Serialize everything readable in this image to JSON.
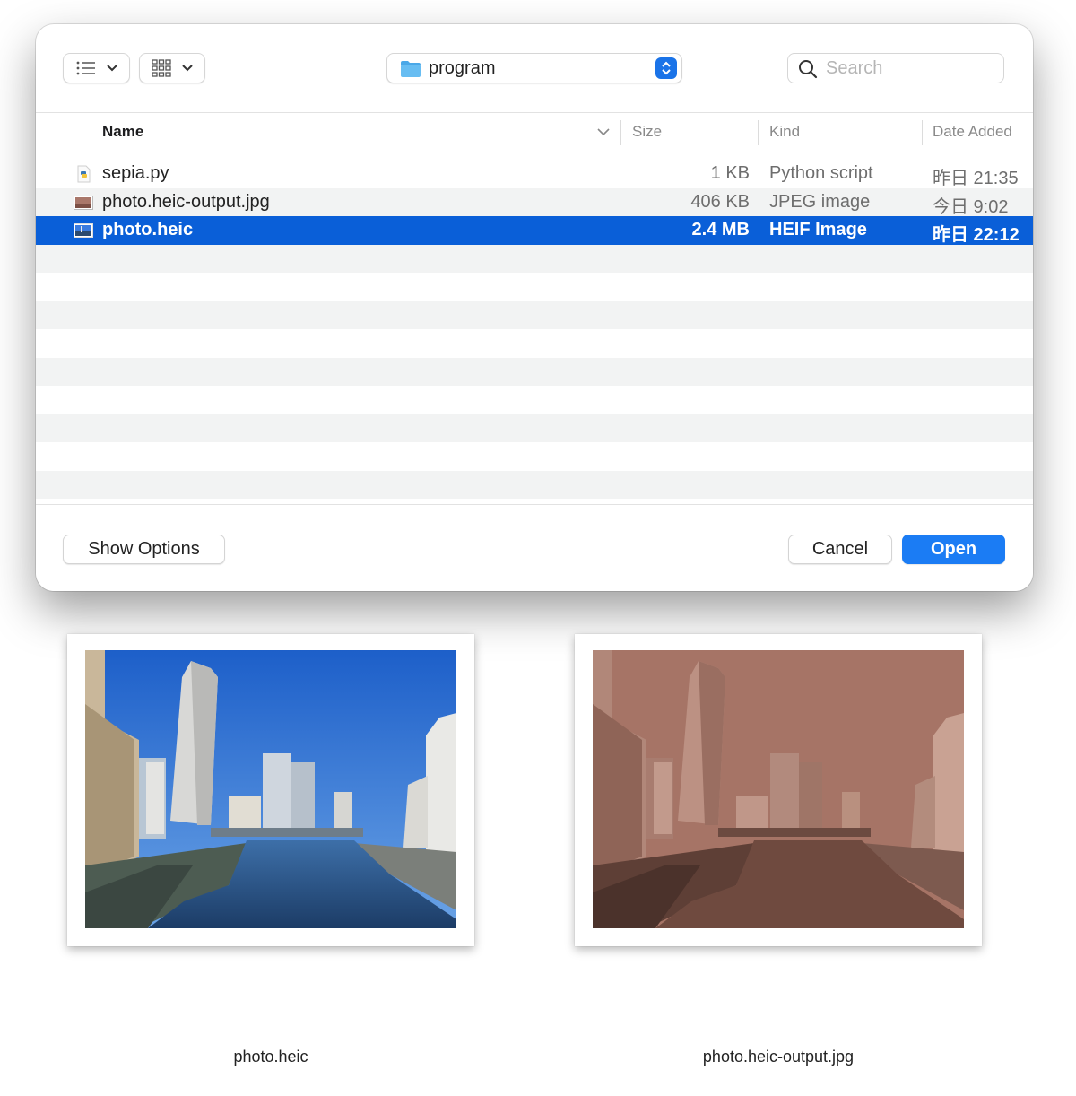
{
  "dialog": {
    "toolbar": {
      "list_view_icon": "list-icon",
      "grid_view_icon": "grid-icon",
      "location": "program",
      "location_icon": "folder-icon",
      "search_placeholder": "Search",
      "search_value": ""
    },
    "columns": {
      "name": "Name",
      "size": "Size",
      "kind": "Kind",
      "date": "Date Added"
    },
    "files": [
      {
        "name": "sepia.py",
        "size": "1 KB",
        "kind": "Python script",
        "date": "昨日 21:35",
        "icon": "python-file-icon",
        "selected": false
      },
      {
        "name": "photo.heic-output.jpg",
        "size": "406 KB",
        "kind": "JPEG image",
        "date": "今日 9:02",
        "icon": "jpeg-thumbnail-icon",
        "selected": false
      },
      {
        "name": "photo.heic",
        "size": "2.4 MB",
        "kind": "HEIF Image",
        "date": "昨日 22:12",
        "icon": "heif-thumbnail-icon",
        "selected": true
      }
    ],
    "footer": {
      "show_options": "Show Options",
      "cancel": "Cancel",
      "open": "Open"
    },
    "colors": {
      "selection": "#0a5fd8",
      "primary_button": "#1b7cf4"
    }
  },
  "previews": [
    {
      "caption": "photo.heic",
      "style": "original color"
    },
    {
      "caption": "photo.heic-output.jpg",
      "style": "sepia"
    }
  ]
}
